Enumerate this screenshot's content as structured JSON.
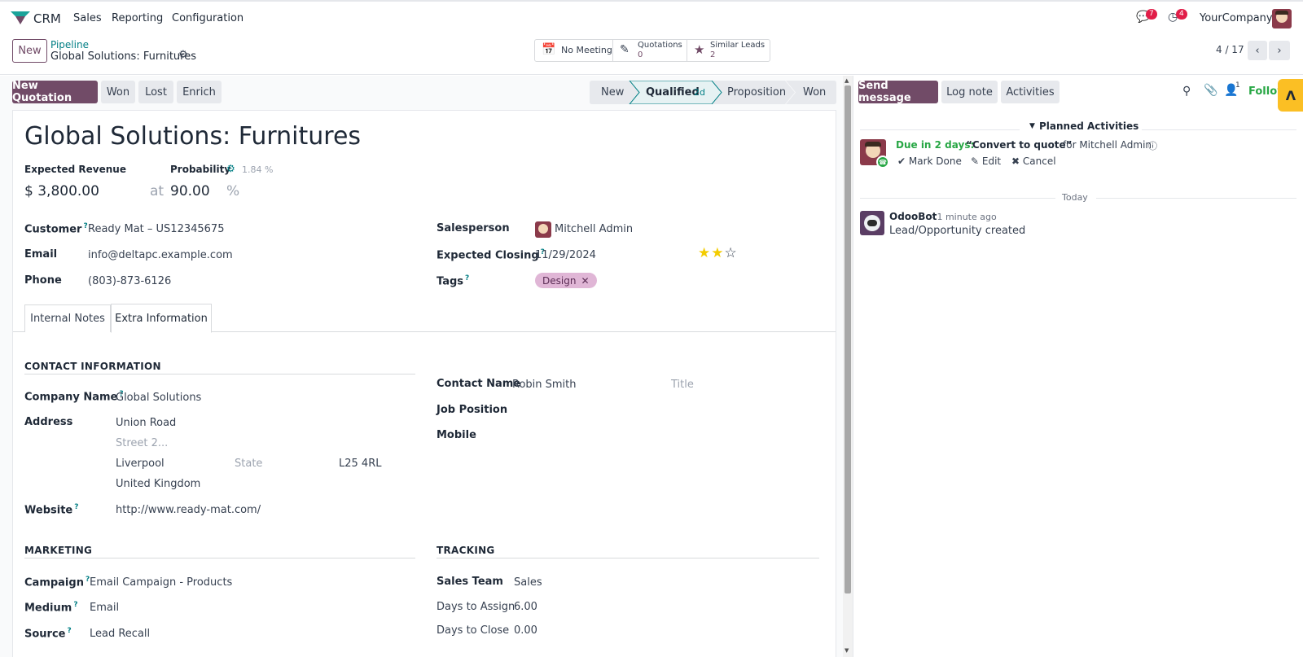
{
  "navbar": {
    "app_name": "CRM",
    "menus": [
      "Sales",
      "Reporting",
      "Configuration"
    ],
    "messages_count": "7",
    "activities_count": "4",
    "company": "YourCompany"
  },
  "control": {
    "new_label": "New",
    "breadcrumb_parent": "Pipeline",
    "breadcrumb_current": "Global Solutions: Furnitures",
    "pager": "4 / 17",
    "smart_buttons": {
      "meeting": "No Meeting",
      "quotations_label": "Quotations",
      "quotations_count": "0",
      "similar_label": "Similar Leads",
      "similar_count": "2"
    }
  },
  "actions": {
    "new_quotation": "New Quotation",
    "won": "Won",
    "lost": "Lost",
    "enrich": "Enrich"
  },
  "stages": {
    "new": "New",
    "qualified": "Qualified",
    "qualified_duration": "2d",
    "proposition": "Proposition",
    "won": "Won"
  },
  "form": {
    "title": "Global Solutions: Furnitures",
    "expected_revenue_label": "Expected Revenue",
    "expected_revenue": "$ 3,800.00",
    "probability_label": "Probability",
    "probability_auto": "1.84 %",
    "at_label": "at",
    "probability": "90.00",
    "percent": "%",
    "customer_label": "Customer",
    "customer": "Ready Mat – US12345675",
    "email_label": "Email",
    "email": "info@deltapc.example.com",
    "phone_label": "Phone",
    "phone": "(803)-873-6126",
    "salesperson_label": "Salesperson",
    "salesperson": "Mitchell Admin",
    "expected_closing_label": "Expected Closing",
    "expected_closing": "11/29/2024",
    "priority_stars": 2,
    "tags_label": "Tags",
    "tag": "Design"
  },
  "tabs": {
    "internal_notes": "Internal Notes",
    "extra_information": "Extra Information"
  },
  "extra": {
    "contact_info_title": "CONTACT INFORMATION",
    "company_name_label": "Company Name",
    "company_name": "Global Solutions",
    "address_label": "Address",
    "street": "Union Road",
    "street2_placeholder": "Street 2...",
    "city": "Liverpool",
    "state_placeholder": "State",
    "zip": "L25 4RL",
    "country": "United Kingdom",
    "website_label": "Website",
    "website": "http://www.ready-mat.com/",
    "contact_name_label": "Contact Name",
    "contact_name": "Robin Smith",
    "title_placeholder": "Title",
    "job_position_label": "Job Position",
    "mobile_label": "Mobile",
    "marketing_title": "MARKETING",
    "campaign_label": "Campaign",
    "campaign": "Email Campaign - Products",
    "medium_label": "Medium",
    "medium": "Email",
    "source_label": "Source",
    "source": "Lead Recall",
    "tracking_title": "TRACKING",
    "sales_team_label": "Sales Team",
    "sales_team": "Sales",
    "days_to_assign_label": "Days to Assign",
    "days_to_assign": "6.00",
    "days_to_close_label": "Days to Close",
    "days_to_close": "0.00"
  },
  "chatter": {
    "send_message": "Send message",
    "log_note": "Log note",
    "activities": "Activities",
    "followers_count": "1",
    "follow": "Follow",
    "planned_activities": "Planned Activities",
    "due": "Due in 2 days:",
    "activity_summary": "“Convert to quote”",
    "for_user": "for Mitchell Admin",
    "mark_done": "Mark Done",
    "edit": "Edit",
    "cancel": "Cancel",
    "today": "Today",
    "author": "OdooBot",
    "time": "- 1 minute ago",
    "message": "Lead/Opportunity created"
  }
}
